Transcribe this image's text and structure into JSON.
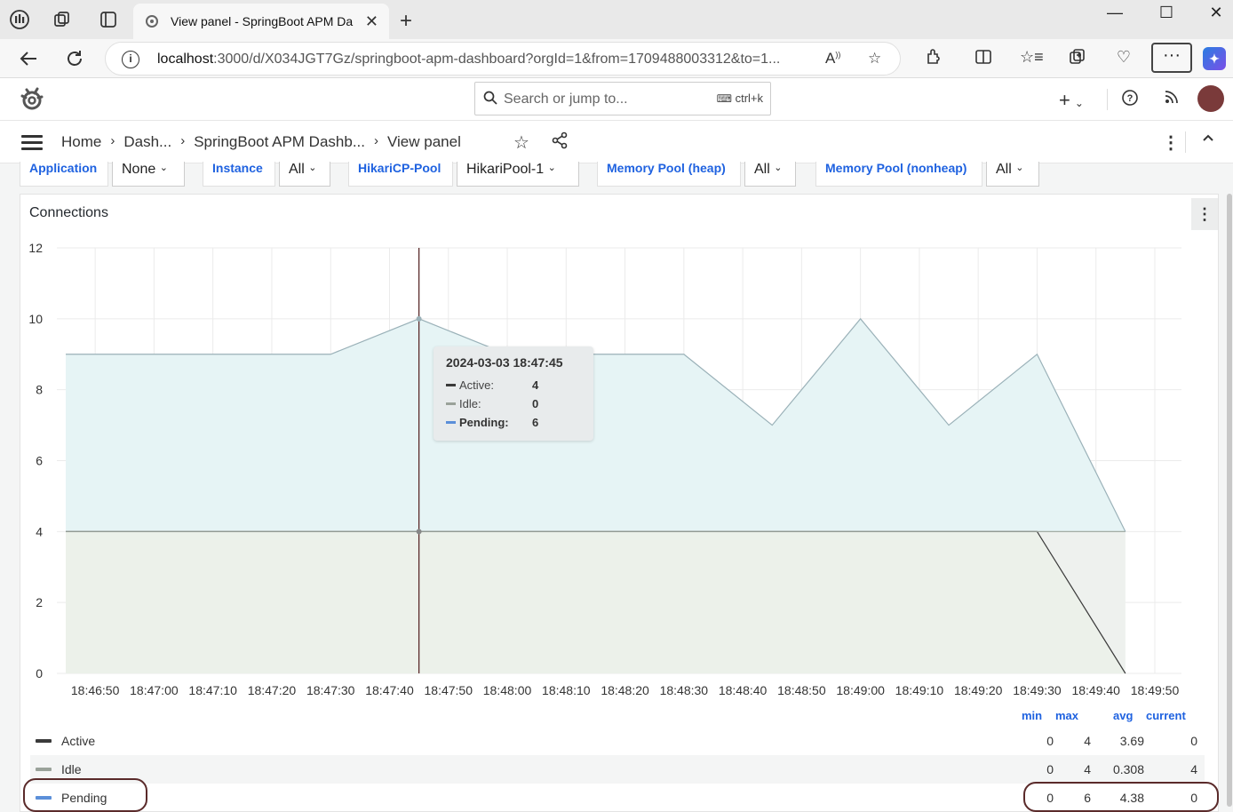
{
  "browser": {
    "tab_title": "View panel - SpringBoot APM Da",
    "url_host": "localhost",
    "url_rest": ":3000/d/X034JGT7Gz/springboot-apm-dashboard?orgId=1&from=1709488003312&to=1...",
    "icons": [
      "workspaces-icon",
      "collections-icon",
      "tab-actions-icon",
      "back-icon",
      "refresh-icon",
      "read-aloud-icon",
      "favorite-icon",
      "extensions-icon",
      "split-screen-icon",
      "favorites-icon",
      "collections-icon",
      "browser-essentials-icon",
      "more-icon",
      "copilot-icon"
    ]
  },
  "grafana": {
    "search_placeholder": "Search or jump to...",
    "search_shortcut": "ctrl+k",
    "breadcrumb": [
      "Home",
      "Dash...",
      "SpringBoot APM Dashb...",
      "View panel"
    ]
  },
  "variables": [
    {
      "label": "Application",
      "value": "None"
    },
    {
      "label": "Instance",
      "value": "All"
    },
    {
      "label": "HikariCP-Pool",
      "value": "HikariPool-1"
    },
    {
      "label": "Memory Pool (heap)",
      "value": "All"
    },
    {
      "label": "Memory Pool (nonheap)",
      "value": "All"
    }
  ],
  "panel": {
    "title": "Connections"
  },
  "tooltip": {
    "time": "2024-03-03 18:47:45",
    "rows": [
      {
        "label": "Active:",
        "value": "4"
      },
      {
        "label": "Idle:",
        "value": "0"
      },
      {
        "label": "Pending:",
        "value": "6"
      }
    ]
  },
  "legend": {
    "headers": [
      "min",
      "max",
      "avg",
      "current"
    ],
    "rows": [
      {
        "name": "Active",
        "min": "0",
        "max": "4",
        "avg": "3.69",
        "current": "0"
      },
      {
        "name": "Idle",
        "min": "0",
        "max": "4",
        "avg": "0.308",
        "current": "4"
      },
      {
        "name": "Pending",
        "min": "0",
        "max": "6",
        "avg": "4.38",
        "current": "0"
      }
    ]
  },
  "colors": {
    "active": "#3a3a3a",
    "idle": "#9aa29a",
    "pending": "#5b8fd9",
    "pending_fill": "#e6f4f5",
    "active_fill": "#ecf1ea",
    "link_blue": "#1f62e0",
    "highlight_ring": "#5a2a2a"
  },
  "chart_data": {
    "type": "area",
    "stacked": true,
    "ylim": [
      0,
      12
    ],
    "yticks": [
      "0",
      "2",
      "4",
      "6",
      "8",
      "10",
      "12"
    ],
    "xticks": [
      "18:46:50",
      "18:47:00",
      "18:47:10",
      "18:47:20",
      "18:47:30",
      "18:47:40",
      "18:47:50",
      "18:48:00",
      "18:48:10",
      "18:48:20",
      "18:48:30",
      "18:48:40",
      "18:48:50",
      "18:49:00",
      "18:49:10",
      "18:49:20",
      "18:49:30",
      "18:49:40",
      "18:49:50"
    ],
    "x": [
      "18:46:45",
      "18:47:00",
      "18:47:15",
      "18:47:30",
      "18:47:45",
      "18:48:00",
      "18:48:15",
      "18:48:30",
      "18:48:45",
      "18:49:00",
      "18:49:15",
      "18:49:30",
      "18:49:45"
    ],
    "series": [
      {
        "name": "Active",
        "values": [
          4,
          4,
          4,
          4,
          4,
          4,
          4,
          4,
          4,
          4,
          4,
          4,
          0
        ]
      },
      {
        "name": "Idle",
        "values": [
          0,
          0,
          0,
          0,
          0,
          0,
          0,
          0,
          0,
          0,
          0,
          0,
          4
        ]
      },
      {
        "name": "Pending",
        "values": [
          5,
          5,
          5,
          5,
          6,
          5,
          5,
          5,
          3,
          6,
          3,
          5,
          0
        ]
      }
    ],
    "crosshair_x": "18:47:45",
    "grid": true
  }
}
